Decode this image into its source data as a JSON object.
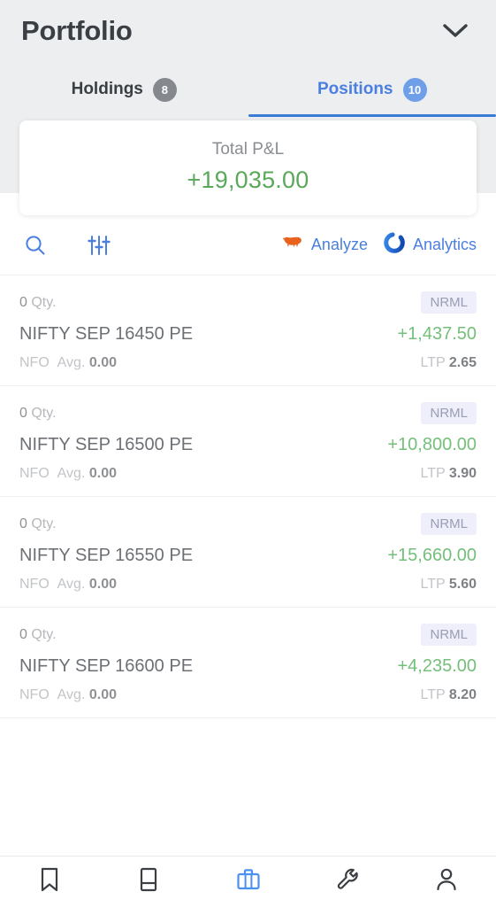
{
  "header": {
    "title": "Portfolio",
    "chevron_icon": "chevron-down-icon"
  },
  "tabs": [
    {
      "label": "Holdings",
      "badge": "8",
      "active": false
    },
    {
      "label": "Positions",
      "badge": "10",
      "active": true
    }
  ],
  "pnl_card": {
    "label": "Total P&L",
    "value": "+19,035.00",
    "value_color": "#5aa85a"
  },
  "toolbar": {
    "search_icon": "search-icon",
    "filter_icon": "sliders-filter-icon",
    "links": [
      {
        "label": "Analyze",
        "icon": "bison-icon",
        "icon_color": "#e8611d"
      },
      {
        "label": "Analytics",
        "icon": "ring-icon",
        "icon_color": "#1565d8"
      }
    ],
    "link_color": "#4a7fe0"
  },
  "positions": [
    {
      "qty_value": "0",
      "qty_label": "Qty.",
      "product": "NRML",
      "instrument": "NIFTY SEP 16450 PE",
      "pnl": "+1,437.50",
      "exchange": "NFO",
      "avg_label": "Avg.",
      "avg_value": "0.00",
      "ltp_label": "LTP",
      "ltp_value": "2.65"
    },
    {
      "qty_value": "0",
      "qty_label": "Qty.",
      "product": "NRML",
      "instrument": "NIFTY SEP 16500 PE",
      "pnl": "+10,800.00",
      "exchange": "NFO",
      "avg_label": "Avg.",
      "avg_value": "0.00",
      "ltp_label": "LTP",
      "ltp_value": "3.90"
    },
    {
      "qty_value": "0",
      "qty_label": "Qty.",
      "product": "NRML",
      "instrument": "NIFTY SEP 16550 PE",
      "pnl": "+15,660.00",
      "exchange": "NFO",
      "avg_label": "Avg.",
      "avg_value": "0.00",
      "ltp_label": "LTP",
      "ltp_value": "5.60"
    },
    {
      "qty_value": "0",
      "qty_label": "Qty.",
      "product": "NRML",
      "instrument": "NIFTY SEP 16600 PE",
      "pnl": "+4,235.00",
      "exchange": "NFO",
      "avg_label": "Avg.",
      "avg_value": "0.00",
      "ltp_label": "LTP",
      "ltp_value": "8.20"
    }
  ],
  "bottom_nav": [
    {
      "icon": "bookmark-icon",
      "active": false
    },
    {
      "icon": "book-icon",
      "active": false
    },
    {
      "icon": "briefcase-icon",
      "active": true
    },
    {
      "icon": "wrench-icon",
      "active": false
    },
    {
      "icon": "person-icon",
      "active": false
    }
  ],
  "colors": {
    "accent_blue": "#4a7fe0",
    "positive_green": "#74bf7a",
    "header_bg": "#eceef0",
    "badge_bg": "#eeeffa"
  }
}
